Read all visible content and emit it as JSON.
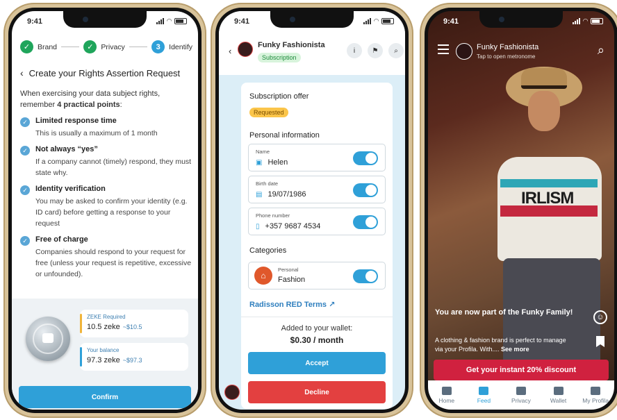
{
  "status": {
    "time": "9:41"
  },
  "phone1": {
    "steps": [
      {
        "label": "Brand",
        "marker": "✓"
      },
      {
        "label": "Privacy",
        "marker": "✓"
      },
      {
        "label": "Identify",
        "marker": "3"
      }
    ],
    "title": "Create your Rights Assertion Request",
    "intro_prefix": "When exercising your data subject rights, remember ",
    "intro_bold": "4 practical points",
    "intro_suffix": ":",
    "points": [
      {
        "heading": "Limited response time",
        "body": "This is usually a maximum of 1 month"
      },
      {
        "heading": "Not always “yes”",
        "body": "If a company cannot (timely) respond, they must state why."
      },
      {
        "heading": "Identity verification",
        "body": "You may be asked to confirm your identity (e.g. ID card) before getting a response to your request"
      },
      {
        "heading": "Free of charge",
        "body": "Companies should respond to your request for free (unless your request is repetitive, excessive or unfounded)."
      }
    ],
    "zeke_required_label": "ZEKE Required",
    "zeke_required_value": "10.5 zeke",
    "zeke_required_fiat": "~$10.5",
    "balance_label": "Your balance",
    "balance_value": "97.3 zeke",
    "balance_fiat": "~$97.3",
    "confirm_label": "Confirm",
    "colors": {
      "green": "#1fa55b",
      "blue": "#2fa0d8",
      "amber": "#f0b43a"
    }
  },
  "phone2": {
    "brand_name": "Funky Fashionista",
    "brand_tag": "Subscription",
    "header_icons": [
      "info-icon",
      "stamp-icon",
      "search-icon"
    ],
    "offer_title": "Subscription offer",
    "offer_status": "Requested",
    "personal_title": "Personal information",
    "fields": [
      {
        "label": "Name",
        "value": "Helen",
        "icon": "id-card-icon",
        "glyph": "▣"
      },
      {
        "label": "Birth date",
        "value": "19/07/1986",
        "icon": "calendar-icon",
        "glyph": "▤"
      },
      {
        "label": "Phone number",
        "value": "+357 9687 4534",
        "icon": "phone-icon",
        "glyph": "▯"
      }
    ],
    "categories_title": "Categories",
    "category": {
      "label": "Personal",
      "value": "Fashion",
      "icon": "hanger-icon"
    },
    "terms_label": "Radisson RED Terms",
    "wallet_text": "Added to your wallet:",
    "wallet_amount": "$0.30 / month",
    "accept_label": "Accept",
    "decline_label": "Decline"
  },
  "phone3": {
    "brand_name": "Funky Fashionista",
    "brand_sub": "Tap to open metronome",
    "shirt_print": "IRLISM",
    "headline": "You are now part of the Funky Family!",
    "description": "A clothing & fashion brand is perfect to manage via your Profila. With....",
    "see_more": "See more",
    "cta_label": "Get your instant 20% discount",
    "tabs": [
      {
        "label": "Home",
        "icon": "home-icon",
        "active": false
      },
      {
        "label": "Feed",
        "icon": "tag-icon",
        "active": true
      },
      {
        "label": "Privacy",
        "icon": "shield-icon",
        "active": false
      },
      {
        "label": "Wallet",
        "icon": "wallet-icon",
        "active": false
      },
      {
        "label": "My Profila",
        "icon": "person-icon",
        "active": false
      }
    ],
    "colors": {
      "cta": "#d0213f",
      "stripe_teal": "#2ea6b6",
      "stripe_red": "#c4283f"
    }
  }
}
